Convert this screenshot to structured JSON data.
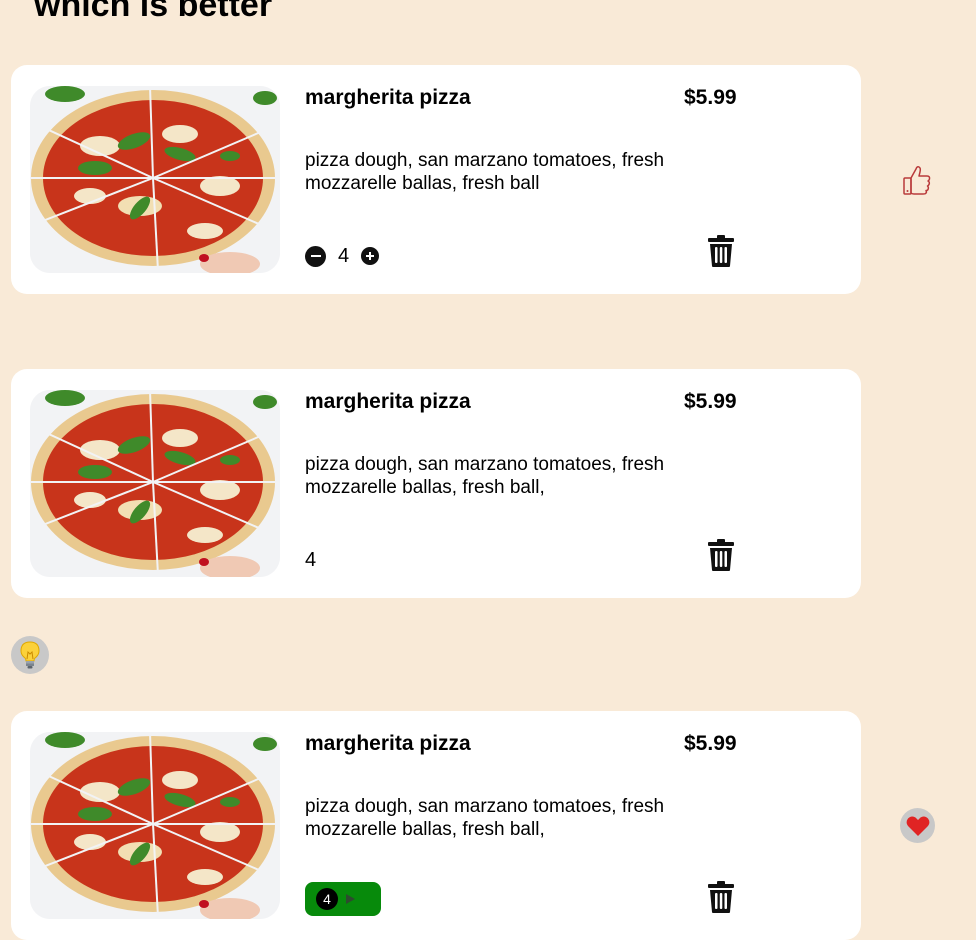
{
  "page": {
    "title": "which is better"
  },
  "cards": [
    {
      "name": "margherita pizza",
      "price": "$5.99",
      "description": "pizza dough, san marzano tomatoes, fresh mozzarelle ballas, fresh ball",
      "quantity": "4",
      "controls": "stepper"
    },
    {
      "name": "margherita pizza",
      "price": "$5.99",
      "description": "pizza dough, san marzano tomatoes, fresh mozzarelle ballas, fresh ball,",
      "quantity": "4",
      "controls": "plain"
    },
    {
      "name": "margherita pizza",
      "price": "$5.99",
      "description": "pizza dough, san marzano tomatoes, fresh mozzarelle ballas, fresh ball,",
      "quantity": "4",
      "controls": "pill"
    }
  ],
  "icons": {
    "thumbs_up": "thumbs-up-icon",
    "bulb": "lightbulb-icon",
    "heart": "heart-icon",
    "trash": "trash-icon"
  },
  "colors": {
    "background": "#f9ead7",
    "pill": "#078a0b",
    "heart": "#e02424",
    "thumb": "#b93a3a"
  }
}
